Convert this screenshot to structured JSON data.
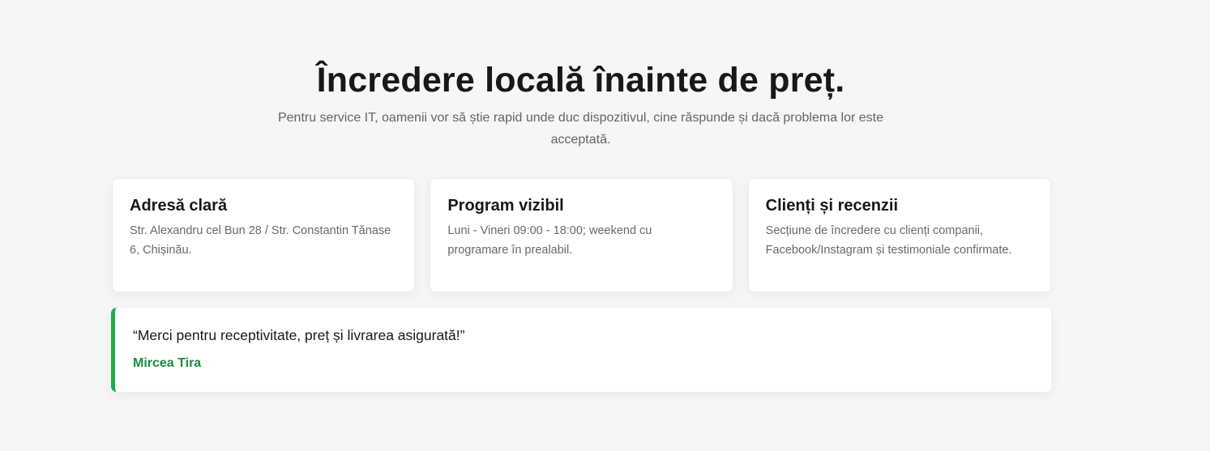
{
  "header": {
    "title": "Încredere locală înainte de preț.",
    "subtitle": "Pentru service IT, oamenii vor să știe rapid unde duc dispozitivul, cine răspunde și dacă problema lor este acceptată."
  },
  "cards": [
    {
      "title": "Adresă clară",
      "text": "Str. Alexandru cel Bun 28 / Str. Constantin Tănase 6, Chișinău."
    },
    {
      "title": "Program vizibil",
      "text": "Luni - Vineri 09:00 - 18:00; weekend cu programare în prealabil."
    },
    {
      "title": "Clienți și recenzii",
      "text": "Secțiune de încredere cu clienți companii, Facebook/Instagram și testimoniale confirmate."
    }
  ],
  "testimonial": {
    "quote": "“Merci pentru receptivitate, preț și livrarea asigurată!”",
    "author": "Mircea Tira"
  },
  "colors": {
    "background": "#f5f6f5",
    "accent": "#1fab4c",
    "author": "#1b8d3e",
    "heading": "#15181d",
    "muted": "#636a74"
  }
}
